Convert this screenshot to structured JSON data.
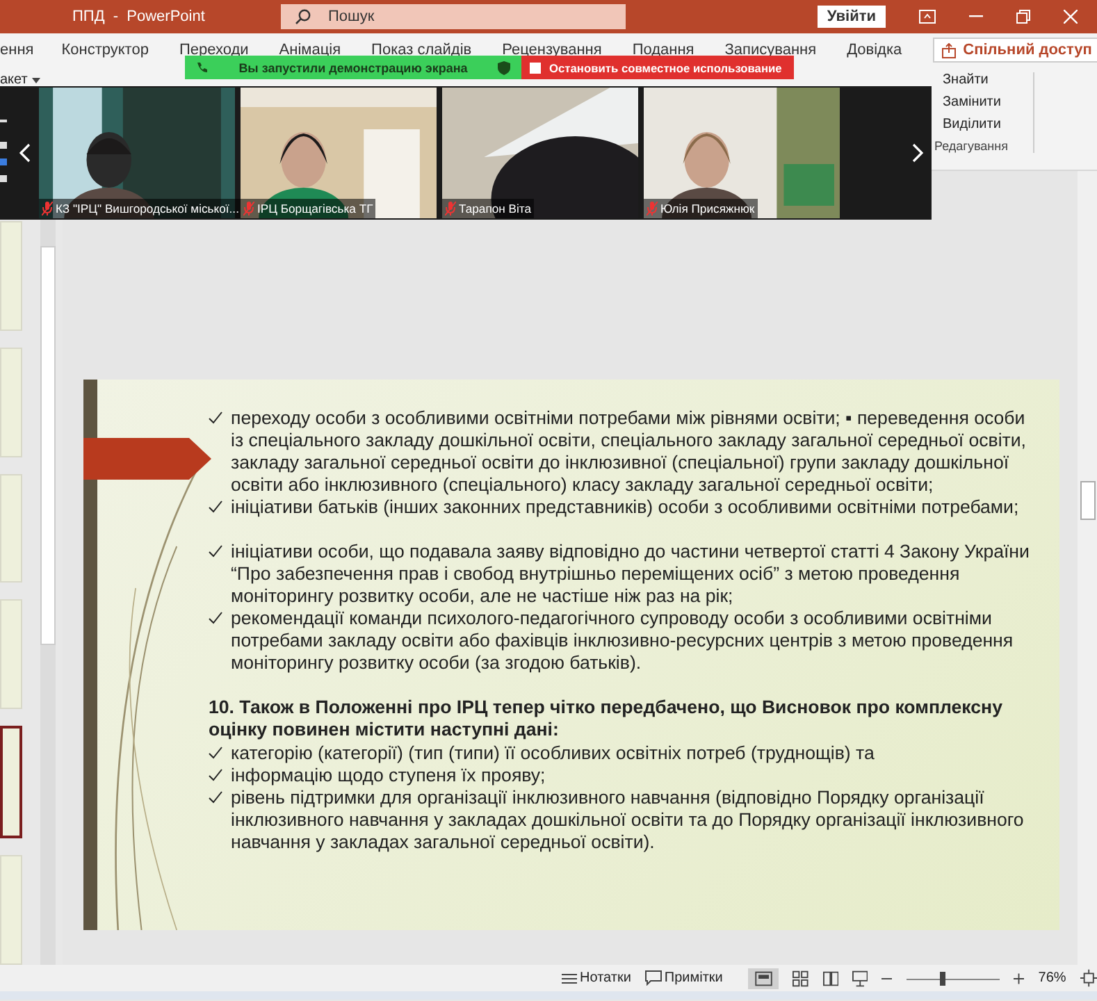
{
  "window": {
    "title": "ППД  -  PowerPoint",
    "search": {
      "placeholder": "Пошук"
    },
    "sign_in": "Увійти"
  },
  "ribbon": {
    "tabs": [
      {
        "label": "ення",
        "selected": false
      },
      {
        "label": "Конструктор",
        "selected": false
      },
      {
        "label": "Переходи",
        "selected": false
      },
      {
        "label": "Анімація",
        "selected": false
      },
      {
        "label": "Показ слайдів",
        "selected": false
      },
      {
        "label": "Рецензування",
        "selected": false
      },
      {
        "label": "Подання",
        "selected": false
      },
      {
        "label": "Записування",
        "selected": false
      },
      {
        "label": "Довідка",
        "selected": false
      }
    ],
    "share": "Спільний доступ",
    "layout_button": "акет",
    "editing": {
      "items": [
        "Знайти",
        "Замінити",
        "Виділити"
      ],
      "group": "Редагування"
    }
  },
  "share_banner": {
    "status": "Вы запустили демонстрацию экрана",
    "stop": "Остановить совместное использование"
  },
  "video_strip": {
    "participants": [
      {
        "name": "КЗ \"ІРЦ\" Вишгородської міської...",
        "muted": true
      },
      {
        "name": "ІРЦ Борщагівська ТГ",
        "muted": true
      },
      {
        "name": "Тарапон Віта",
        "muted": true
      },
      {
        "name": "Юлія Присяжнюк",
        "muted": true
      }
    ]
  },
  "thumbnails": [
    {
      "selected": false
    },
    {
      "selected": false
    },
    {
      "selected": false
    },
    {
      "selected": false
    },
    {
      "selected": true
    },
    {
      "selected": false
    }
  ],
  "slide": {
    "items": [
      {
        "kind": "check",
        "text": "переходу особи з особливими освітніми потребами між рівнями освіти; ▪ переведення особи із спеціального закладу дошкільної освіти, спеціального закладу загальної середньої освіти, закладу загальної середньої освіти до інклюзивної (спеціальної) групи закладу дошкільної освіти або інклюзивного (спеціального) класу закладу загальної середньої освіти;",
        "gap_before": false
      },
      {
        "kind": "check",
        "text": "ініціативи батьків (інших законних представників) особи з особливими освітніми потребами;",
        "gap_before": false
      },
      {
        "kind": "check",
        "text": "ініціативи особи, що подавала заяву відповідно до частини четвертої статті 4 Закону України “Про забезпечення прав і свобод внутрішньо переміщених осіб” з метою проведення моніторингу розвитку особи, але не частіше ніж раз на рік;",
        "gap_before": true
      },
      {
        "kind": "check",
        "text": "рекомендації команди психолого-педагогічного супроводу особи з особливими освітніми потребами закладу освіти або фахівців інклюзивно-ресурсних центрів з метою проведення моніторингу розвитку особи (за згодою батьків).",
        "gap_before": false
      },
      {
        "kind": "heading",
        "text": "10. Також в Положенні про ІРЦ тепер чітко передбачено, що Висновок про комплексну оцінку повинен містити наступні дані:",
        "gap_before": true
      },
      {
        "kind": "check",
        "text": "категорію (категорії) (тип (типи) її особливих освітніх потреб (труднощів) та",
        "gap_before": false
      },
      {
        "kind": "check",
        "text": "інформацію щодо ступеня їх прояву;",
        "gap_before": false
      },
      {
        "kind": "check",
        "text": "рівень підтримки для організації інклюзивного навчання (відповідно Порядку організації інклюзивного навчання у закладах дошкільної освіти та до Порядку організації інклюзивного навчання у закладах загальної середньої освіти).",
        "gap_before": false
      }
    ]
  },
  "status_bar": {
    "notes": "Нотатки",
    "comments": "Примітки",
    "zoom": {
      "level": 0.36
    },
    "zoom_reading": "76%"
  }
}
